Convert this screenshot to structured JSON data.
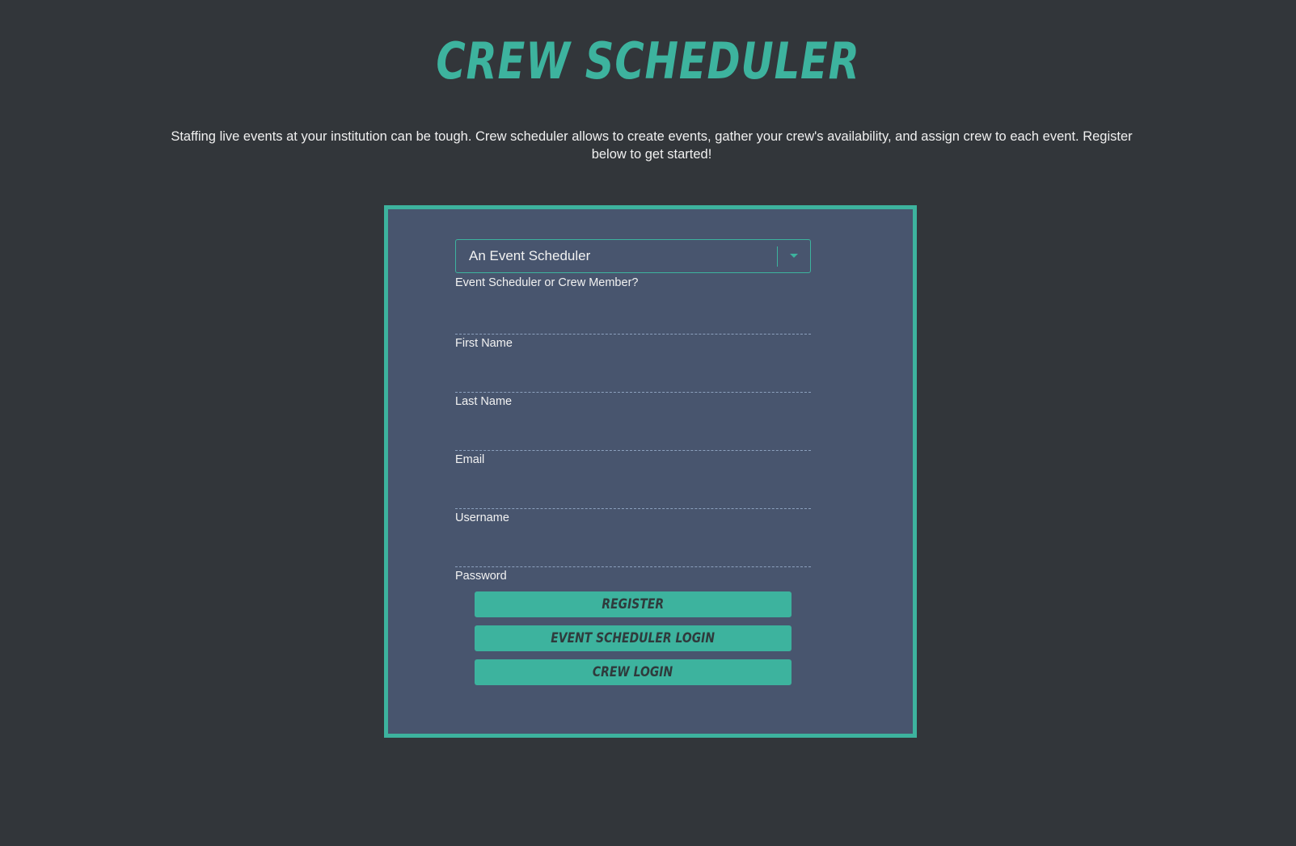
{
  "header": {
    "title": "Crew Scheduler",
    "intro": "Staffing live events at your institution can be tough. Crew scheduler allows to create events, gather your crew's availability, and assign crew to each event. Register below to get started!"
  },
  "form": {
    "role_select": {
      "value": "An Event Scheduler",
      "label": "Event Scheduler or Crew Member?",
      "icon": "chevron-down-icon"
    },
    "fields": [
      {
        "label": "First Name",
        "value": ""
      },
      {
        "label": "Last Name",
        "value": ""
      },
      {
        "label": "Email",
        "value": ""
      },
      {
        "label": "Username",
        "value": ""
      },
      {
        "label": "Password",
        "value": ""
      }
    ],
    "buttons": {
      "register": "Register",
      "event_scheduler_login": "Event Scheduler Login",
      "crew_login": "Crew Login"
    }
  },
  "colors": {
    "background": "#32363a",
    "panel": "#48556e",
    "accent": "#3db39e",
    "text": "#f2f2f2"
  }
}
